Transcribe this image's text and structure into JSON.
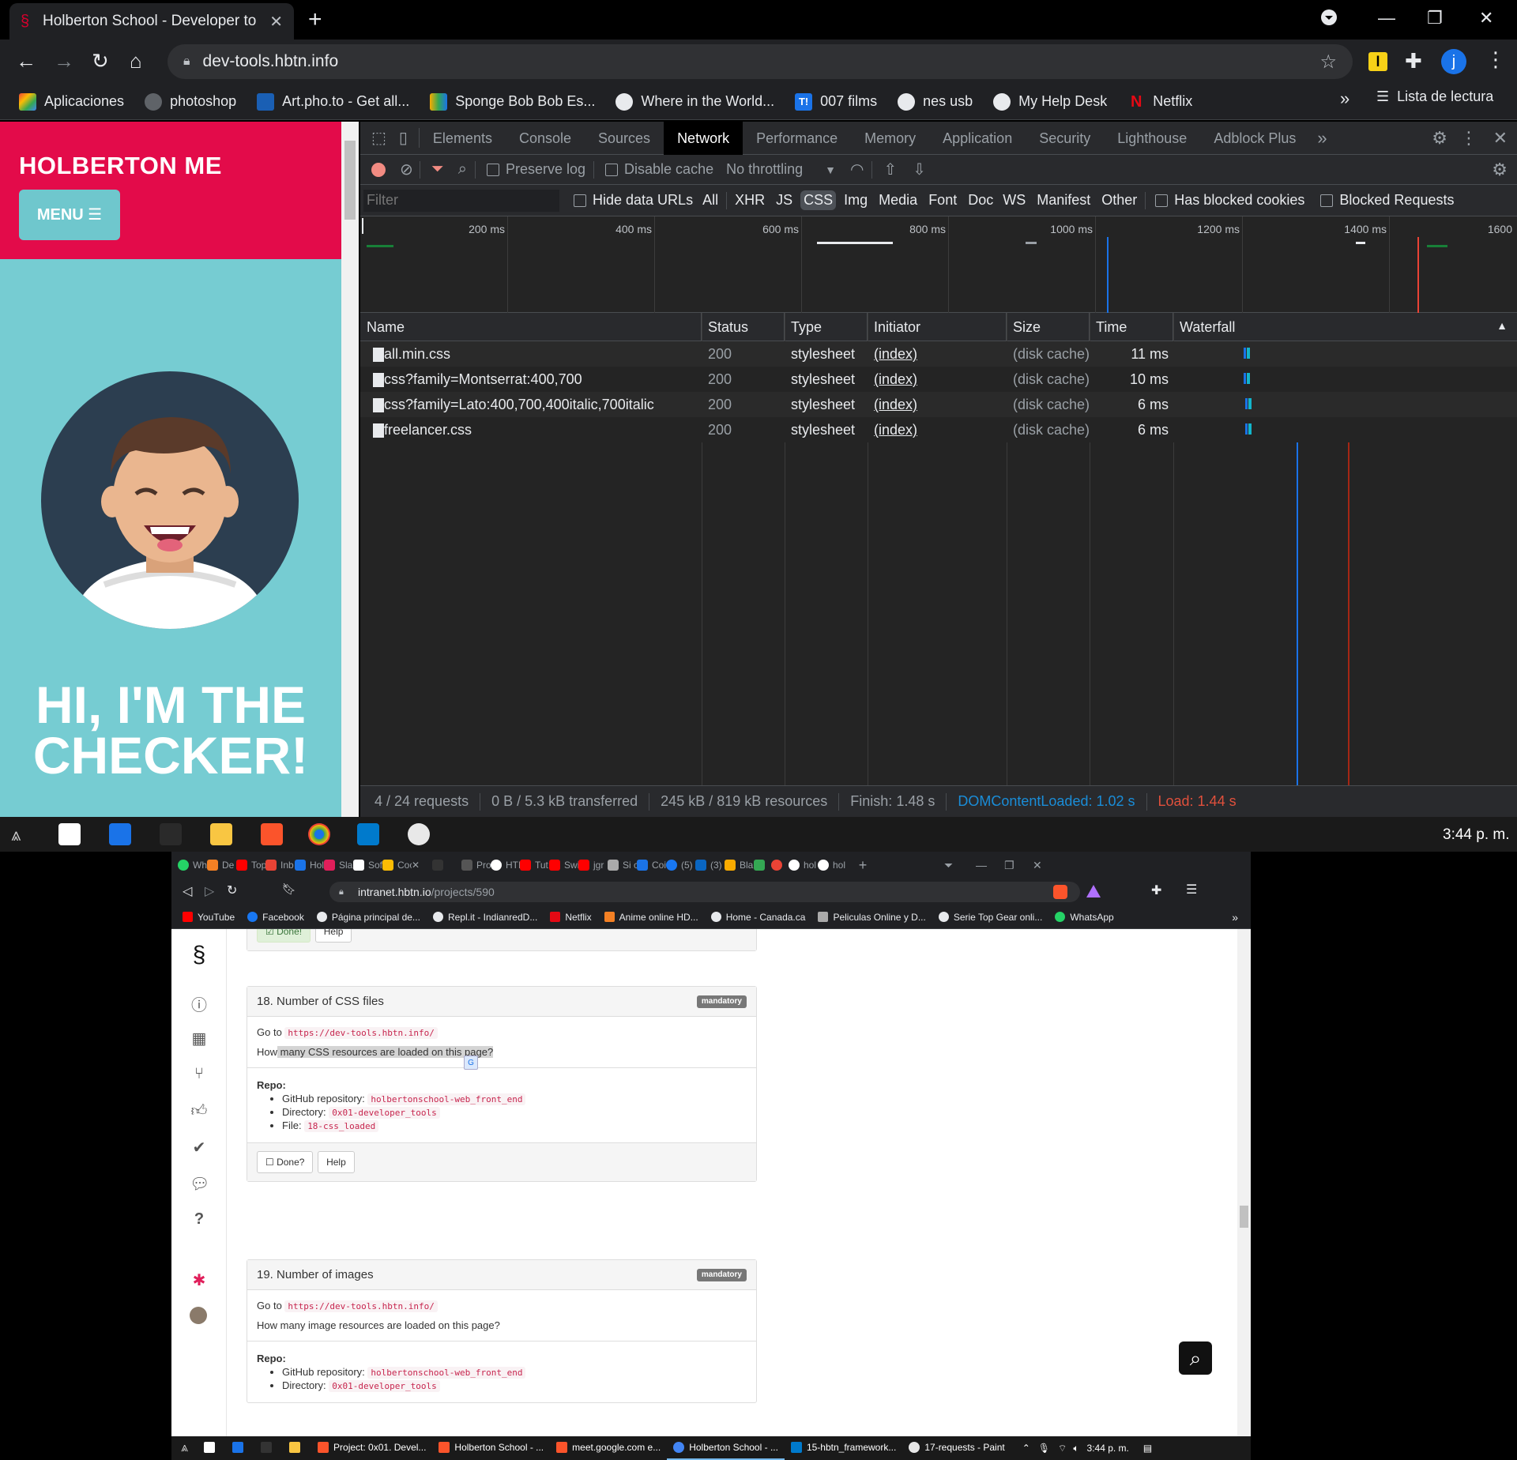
{
  "top_browser": {
    "tab_title": "Holberton School - Developer to",
    "url": "dev-tools.hbtn.info",
    "avatar_letter": "j",
    "bookmarks": [
      {
        "label": "Aplicaciones",
        "color": "#ea4335"
      },
      {
        "label": "photoshop",
        "color": "#5f6368"
      },
      {
        "label": "Art.pho.to - Get all...",
        "color": "#1a5fb4"
      },
      {
        "label": "Sponge Bob Bob Es...",
        "color": "#f9ab00"
      },
      {
        "label": "Where in the World...",
        "color": "#e8eaed"
      },
      {
        "label": "007 films",
        "color": "#1a73e8"
      },
      {
        "label": "nes usb",
        "color": "#e8eaed"
      },
      {
        "label": "My Help Desk",
        "color": "#e8eaed"
      },
      {
        "label": "Netflix",
        "color": "#e50914"
      }
    ],
    "bookmarks_more": "»",
    "reading_list": "Lista de lectura"
  },
  "page": {
    "brand": "HOLBERTON ME",
    "menu_label": "MENU ☰",
    "hero_line1": "HI, I'M THE",
    "hero_line2": "CHECKER!"
  },
  "devtools": {
    "tabs": [
      "Elements",
      "Console",
      "Sources",
      "Network",
      "Performance",
      "Memory",
      "Application",
      "Security",
      "Lighthouse",
      "Adblock Plus"
    ],
    "active_tab": "Network",
    "toolbar": {
      "preserve_log": "Preserve log",
      "disable_cache": "Disable cache",
      "throttling": "No throttling"
    },
    "filter": {
      "placeholder": "Filter",
      "hide_data_urls": "Hide data URLs",
      "types": [
        "All",
        "XHR",
        "JS",
        "CSS",
        "Img",
        "Media",
        "Font",
        "Doc",
        "WS",
        "Manifest",
        "Other"
      ],
      "active_type": "CSS",
      "has_blocked_cookies": "Has blocked cookies",
      "blocked_requests": "Blocked Requests"
    },
    "timeline_ticks": [
      "200 ms",
      "400 ms",
      "600 ms",
      "800 ms",
      "1000 ms",
      "1200 ms",
      "1400 ms",
      "1600"
    ],
    "columns": [
      "Name",
      "Status",
      "Type",
      "Initiator",
      "Size",
      "Time",
      "Waterfall"
    ],
    "rows": [
      {
        "name": "all.min.css",
        "status": "200",
        "type": "stylesheet",
        "initiator": "(index)",
        "size": "(disk cache)",
        "time": "11 ms"
      },
      {
        "name": "css?family=Montserrat:400,700",
        "status": "200",
        "type": "stylesheet",
        "initiator": "(index)",
        "size": "(disk cache)",
        "time": "10 ms"
      },
      {
        "name": "css?family=Lato:400,700,400italic,700italic",
        "status": "200",
        "type": "stylesheet",
        "initiator": "(index)",
        "size": "(disk cache)",
        "time": "6 ms"
      },
      {
        "name": "freelancer.css",
        "status": "200",
        "type": "stylesheet",
        "initiator": "(index)",
        "size": "(disk cache)",
        "time": "6 ms"
      }
    ],
    "status_bar": {
      "requests": "4 / 24 requests",
      "transferred": "0 B / 5.3 kB transferred",
      "resources": "245 kB / 819 kB resources",
      "finish": "Finish: 1.48 s",
      "dom_loaded": "DOMContentLoaded: 1.02 s",
      "load": "Load: 1.44 s"
    }
  },
  "taskbar1": {
    "clock": "3:44 p. m."
  },
  "second_browser": {
    "tabs": [
      "Wh",
      "De",
      "Top",
      "Inb",
      "Hol",
      "Sla",
      "Sof",
      "Coc",
      "",
      "Pro",
      "HTI",
      "Tut",
      "Swi",
      "jgr",
      "Si c",
      "Coi",
      "(5)",
      "(3)",
      "Bla",
      "",
      "hol",
      "hol"
    ],
    "url_host": "intranet.hbtn.io",
    "url_path": "/projects/590",
    "bookmarks": [
      "YouTube",
      "Facebook",
      "Página principal de...",
      "Repl.it - IndianredD...",
      "Netflix",
      "Anime online HD...",
      "Home - Canada.ca",
      "Peliculas Online y D...",
      "Serie Top Gear onli...",
      "WhatsApp"
    ],
    "bookmarks_more": "»"
  },
  "intranet": {
    "prev_done": "Done!",
    "help": "Help",
    "task18": {
      "title": "18. Number of CSS files",
      "badge": "mandatory",
      "goto": "Go to",
      "url": "https://dev-tools.hbtn.info/",
      "question_prefix": "How",
      "question_rest": " many CSS resources are loaded on this page?",
      "repo_label": "Repo:",
      "repo_items": [
        {
          "label": "GitHub repository:",
          "value": "holbertonschool-web_front_end"
        },
        {
          "label": "Directory:",
          "value": "0x01-developer_tools"
        },
        {
          "label": "File:",
          "value": "18-css_loaded"
        }
      ],
      "done": "Done?",
      "help": "Help"
    },
    "task19": {
      "title": "19. Number of images",
      "badge": "mandatory",
      "goto": "Go to",
      "url": "https://dev-tools.hbtn.info/",
      "question": "How many image resources are loaded on this page?",
      "repo_label": "Repo:",
      "repo_items": [
        {
          "label": "GitHub repository:",
          "value": "holbertonschool-web_front_end"
        },
        {
          "label": "Directory:",
          "value": "0x01-developer_tools"
        }
      ]
    }
  },
  "taskbar2": {
    "items": [
      "Project: 0x01. Devel...",
      "Holberton School - ...",
      "meet.google.com e...",
      "Holberton School - ...",
      "15-hbtn_framework...",
      "17-requests - Paint"
    ],
    "clock": "3:44 p. m."
  }
}
